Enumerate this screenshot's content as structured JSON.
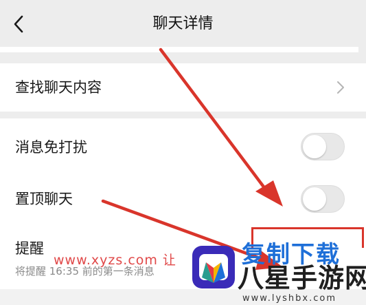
{
  "header": {
    "title": "聊天详情",
    "back_icon": "chevron-left-icon"
  },
  "settings": {
    "search_label": "查找聊天内容",
    "dnd_label": "消息免打扰",
    "dnd_on": false,
    "pin_label": "置顶聊天",
    "pin_on": false,
    "remind_label": "提醒",
    "remind_desc": "将提醒 16:35 前的第一条消息"
  },
  "watermark": {
    "url": "www.xyzs.com 让",
    "brand_fragment": "复制下载",
    "brand_name": "八星手游网",
    "brand_url": "www.lyshbx.com"
  },
  "colors": {
    "background": "#ededed",
    "arrow": "#d9352b",
    "toggle_off": "#e8e8e8"
  }
}
